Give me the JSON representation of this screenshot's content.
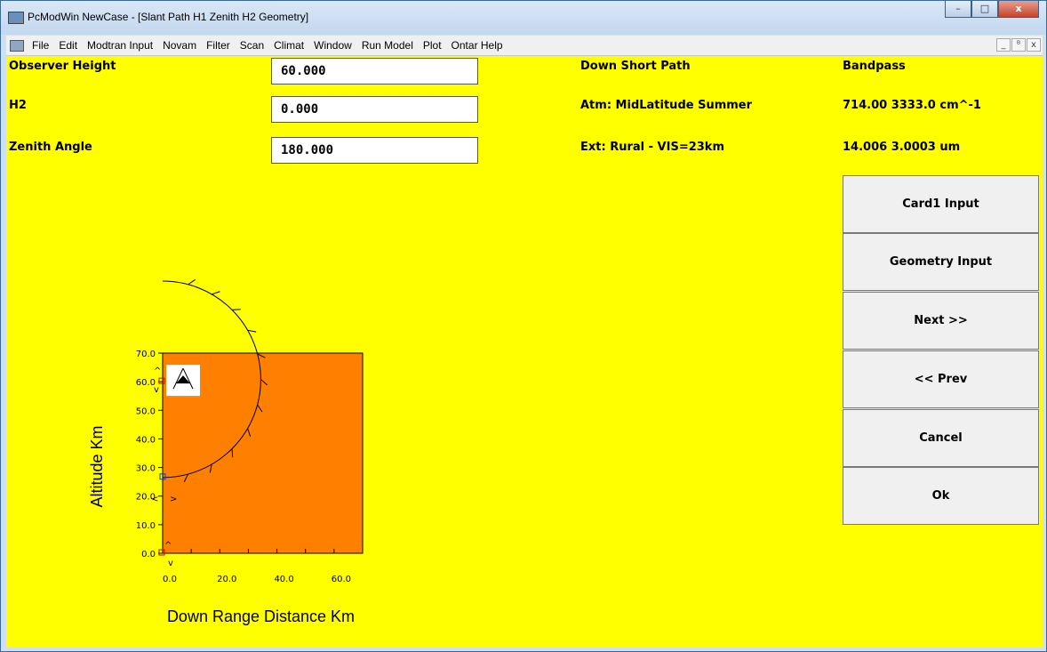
{
  "window": {
    "title": "PcModWin NewCase - [Slant Path H1 Zenith H2 Geometry]",
    "controls": {
      "minimize": "–",
      "maximize": "□",
      "close": "x"
    }
  },
  "menubar": {
    "items": [
      "File",
      "Edit",
      "Modtran Input",
      "Novam",
      "Filter",
      "Scan",
      "Climat",
      "Window",
      "Run Model",
      "Plot",
      "Ontar Help"
    ],
    "mdi_controls": {
      "minimize": "_",
      "restore": "ᴮ",
      "close": "x"
    }
  },
  "form": {
    "observer_height": {
      "label": "Observer Height",
      "value": "60.000"
    },
    "h2": {
      "label": "H2",
      "value": "0.000"
    },
    "zenith_angle": {
      "label": "Zenith Angle",
      "value": "180.000"
    }
  },
  "info": {
    "path": "Down Short Path",
    "atm": "Atm: MidLatitude Summer",
    "ext": "Ext: Rural - VIS=23km",
    "bandpass_title": "Bandpass",
    "wavenumber": "714.00 3333.0 cm^-1",
    "wavelength": "14.006 3.0003 um"
  },
  "buttons": {
    "card1": "Card1 Input",
    "geometry": "Geometry Input",
    "next": "Next >>",
    "prev": "<< Prev",
    "cancel": "Cancel",
    "ok": "Ok"
  },
  "chart_data": {
    "type": "scatter",
    "xlabel": "Down Range Distance Km",
    "ylabel": "Altitude Km",
    "xlim": [
      0,
      70
    ],
    "ylim": [
      0,
      70
    ],
    "xticks": [
      0,
      20,
      40,
      60
    ],
    "yticks": [
      0,
      10,
      20,
      30,
      40,
      50,
      60,
      70
    ],
    "xtick_labels": [
      "0.0",
      "20.0",
      "40.0",
      "60.0"
    ],
    "ytick_labels": [
      "0.0",
      "10.0",
      "20.0",
      "30.0",
      "40.0",
      "50.0",
      "60.0",
      "70.0"
    ],
    "observer_altitude": 60,
    "target_altitude": 0,
    "path_tangent_altitude": 26.5,
    "plot_color": "#ff7f00",
    "marker_glyphs": {
      "up": "^",
      "down": "v",
      "left": "<",
      "right": ">"
    }
  },
  "colors": {
    "background": "#ffff00",
    "plot": "#ff7f00"
  }
}
